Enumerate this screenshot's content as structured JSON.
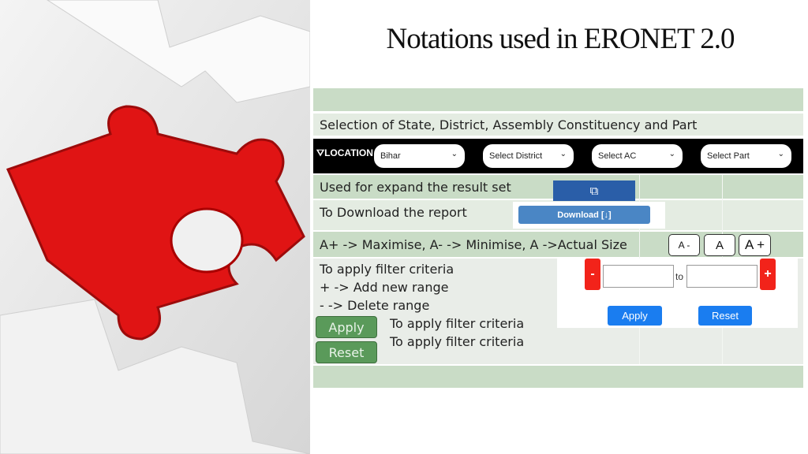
{
  "title": "Notations used in ERONET 2.0",
  "rows": {
    "selection": "Selection of State, District, Assembly Constituency and Part",
    "expand": "Used for expand the result set",
    "download": "To Download the report",
    "fontsize": "A+ -> Maximise, A- -> Minimise, A ->Actual Size",
    "filter1": "To apply filter criteria",
    "filter2": "+ -> Add new range",
    "filter3": "-   -> Delete range",
    "apply_desc": "To apply filter criteria",
    "reset_desc": "To apply filter criteria"
  },
  "location_bar": {
    "label": "LOCATION",
    "icon": "filter-icon",
    "state": "Bihar",
    "district": "Select District",
    "ac": "Select AC",
    "part": "Select Part"
  },
  "buttons": {
    "download": "Download",
    "a_minus": "A -",
    "a": "A",
    "a_plus": "A +",
    "minus": "-",
    "plus": "+",
    "to": "to",
    "apply_blue": "Apply",
    "reset_blue": "Reset",
    "apply_green": "Apply",
    "reset_green": "Reset"
  },
  "colors": {
    "green_row": "#c9dcc6",
    "light_row": "#e4ece2",
    "expand_blue": "#2a5ea8",
    "download_blue": "#4a86c5",
    "red": "#f2231a",
    "bright_blue": "#1a7df0",
    "green_button": "#5a9a5a",
    "puzzle_red": "#e01414"
  }
}
